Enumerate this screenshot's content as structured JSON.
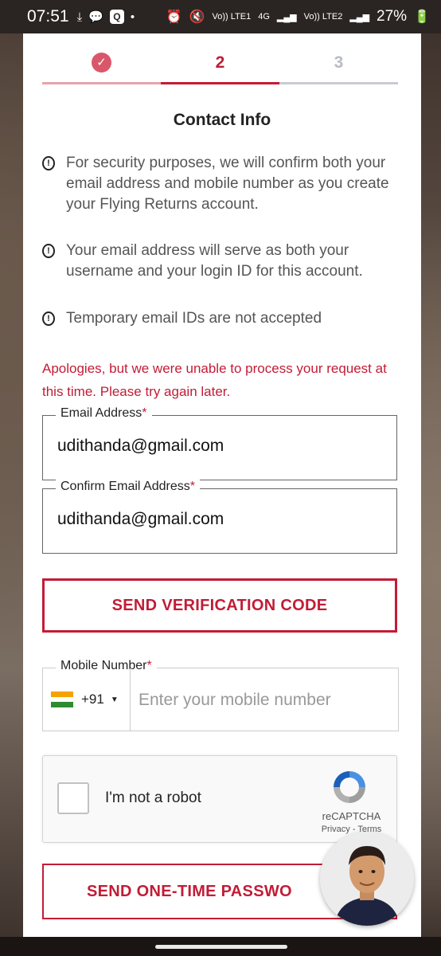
{
  "status_bar": {
    "time": "07:51",
    "left_badge": "Q",
    "signal1": "Vo)) LTE1",
    "net": "4G",
    "signal2": "Vo)) LTE2",
    "battery": "27%"
  },
  "stepper": {
    "step2": "2",
    "step3": "3",
    "colors": {
      "done": "#d9576b",
      "active": "#c21c36",
      "inactive": "#c8cbd0"
    }
  },
  "title": "Contact Info",
  "info_items": [
    "For security purposes, we will confirm both your email address and mobile number as you create your Flying Returns account.",
    "Your email address will serve as both your username and your login ID for this account.",
    "Temporary email IDs are not accepted"
  ],
  "error_message": "Apologies, but we were unable to process your request at this time. Please try again later.",
  "email_field": {
    "label": "Email Address",
    "required": "*",
    "value": "udithanda@gmail.com"
  },
  "confirm_email_field": {
    "label": "Confirm Email Address",
    "required": "*",
    "value": "udithanda@gmail.com"
  },
  "send_verification_button": "SEND VERIFICATION CODE",
  "mobile_field": {
    "label": "Mobile Number",
    "required": "*",
    "country_code": "+91",
    "placeholder": "Enter your mobile number"
  },
  "recaptcha": {
    "label": "I'm not a robot",
    "brand": "reCAPTCHA",
    "privacy": "Privacy",
    "separator": " - ",
    "terms": "Terms"
  },
  "send_otp_button": "SEND ONE-TIME PASSWO",
  "accent_color": "#c21c36"
}
